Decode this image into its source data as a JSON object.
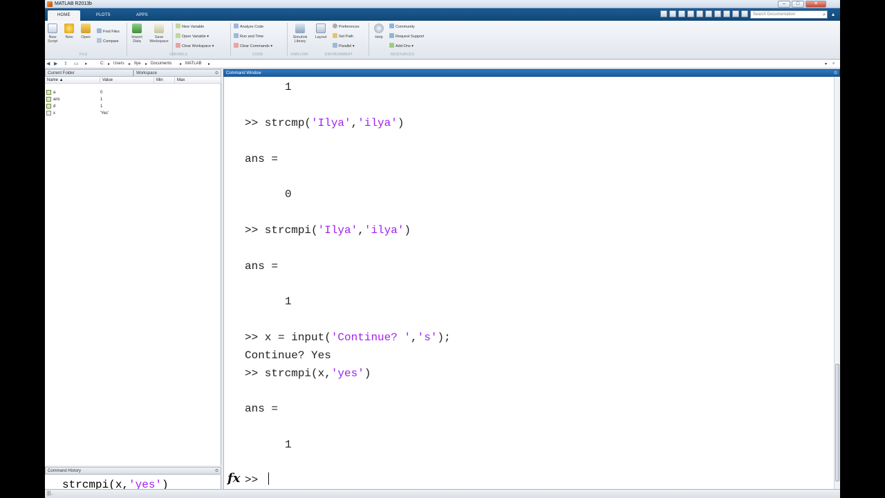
{
  "window": {
    "title": "MATLAB R2013b"
  },
  "tabs": [
    "HOME",
    "PLOTS",
    "APPS"
  ],
  "search": {
    "placeholder": "Search Documentation"
  },
  "ribbon": {
    "new_script": "New Script",
    "new": "New",
    "open": "Open",
    "find_files": "Find Files",
    "compare": "Compare",
    "import_data": "Import Data",
    "save_workspace": "Save Workspace",
    "new_variable": "New Variable",
    "open_variable": "Open Variable",
    "clear_workspace": "Clear Workspace",
    "analyze_code": "Analyze Code",
    "run_and_time": "Run and Time",
    "clear_commands": "Clear Commands",
    "simulink_library": "Simulink Library",
    "layout": "Layout",
    "preferences": "Preferences",
    "set_path": "Set Path",
    "parallel": "Parallel",
    "help": "Help",
    "community": "Community",
    "request_support": "Request Support",
    "add_ons": "Add-Ons",
    "groups": [
      "FILE",
      "VARIABLE",
      "CODE",
      "SIMULINK",
      "ENVIRONMENT",
      "RESOURCES"
    ]
  },
  "path": [
    "C:",
    "Users",
    "Ilya",
    "Documents",
    "MATLAB"
  ],
  "panels": {
    "current_folder": "Current Folder",
    "workspace": "Workspace",
    "command_window": "Command Window",
    "command_history": "Command History"
  },
  "workspace": {
    "columns": [
      "Name ▲",
      "Value",
      "Min",
      "Max"
    ],
    "vars": [
      {
        "name": "a",
        "value": "0"
      },
      {
        "name": "ans",
        "value": "1"
      },
      {
        "name": "d",
        "value": "1"
      },
      {
        "name": "x",
        "value": "'Yes'"
      }
    ]
  },
  "history": {
    "pre": "strcmpi(x,",
    "str": "'yes'",
    "post": ")"
  },
  "command_lines": {
    "l0": "1",
    "l1_pre": ">> strcmp(",
    "l1_a": "'Ilya'",
    "l1_comma": ",",
    "l1_b": "'ilya'",
    "l1_post": ")",
    "l2": "ans =",
    "l3": "0",
    "l4_pre": ">> strcmpi(",
    "l4_a": "'Ilya'",
    "l4_comma": ",",
    "l4_b": "'ilya'",
    "l4_post": ")",
    "l5": "ans =",
    "l6": "1",
    "l7_pre": ">> x = input(",
    "l7_a": "'Continue? '",
    "l7_comma": ",",
    "l7_b": "'s'",
    "l7_post": ");",
    "l8": "Continue? Yes",
    "l9_pre": ">> strcmpi(x,",
    "l9_a": "'yes'",
    "l9_post": ")",
    "l10": "ans =",
    "l11": "1"
  },
  "prompt": {
    "fx": "fx",
    "symbol": ">>"
  },
  "status": {
    "text": "|||.."
  }
}
